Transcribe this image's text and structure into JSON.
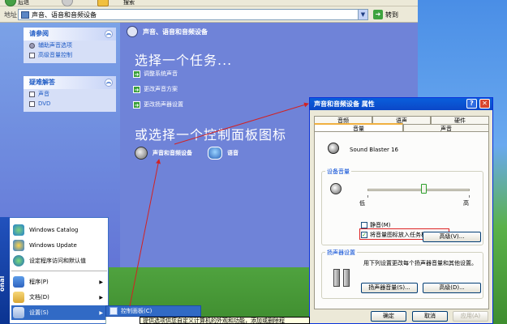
{
  "toolbar": {
    "back_label": "后退",
    "search_label": "搜索"
  },
  "address_bar": {
    "label": "地址",
    "path": "声音、语音和音频设备",
    "go_label": "转到"
  },
  "sidebar": {
    "panels": [
      {
        "title": "请参阅",
        "items": [
          "辅助声音选项",
          "高级音量控制"
        ]
      },
      {
        "title": "疑难解答",
        "items": [
          "声音",
          "DVD"
        ]
      }
    ]
  },
  "main": {
    "title": "声音、语音和音频设备",
    "pick_task": "选择一个任务...",
    "tasks": [
      "调整系统声音",
      "更改声音方案",
      "更改扬声器设置"
    ],
    "or_pick": "或选择一个控制面板图标",
    "icons": [
      "声音和音频设备",
      "语音"
    ]
  },
  "dialog": {
    "title": "声音和音频设备 属性",
    "tabs_row1": [
      "音频",
      "语声",
      "硬件"
    ],
    "tabs_row2": [
      "音量",
      "声音"
    ],
    "device_name": "Sound Blaster 16",
    "volume_group": "设备音量",
    "volume_level": 0.55,
    "low": "低",
    "high": "高",
    "mute": "静音(M)",
    "tray_icon": "将音量图标放入任务栏(I)",
    "advanced": "高级(V)...",
    "speaker_group": "扬声器设置",
    "speaker_desc": "用下列设置更改每个扬声器音量和其他设置。",
    "speaker_volume": "扬声器音量(S)...",
    "advanced2": "高级(D)...",
    "ok": "确定",
    "cancel": "取消",
    "apply": "应用(A)"
  },
  "start_menu": {
    "strip": "onal",
    "items": [
      "Windows Catalog",
      "Windows Update",
      "设定程序访问和默认值",
      "程序(P)",
      "文档(D)",
      "设置(S)"
    ],
    "submenu_item": "控制面板(C)",
    "tooltip": "提供选项供您自定义计算机的外观和功能，添加或删除程"
  },
  "colors": {
    "accent_red": "#d22222",
    "xp_blue": "#0b47c7",
    "task_pane": "#6f83d8"
  }
}
